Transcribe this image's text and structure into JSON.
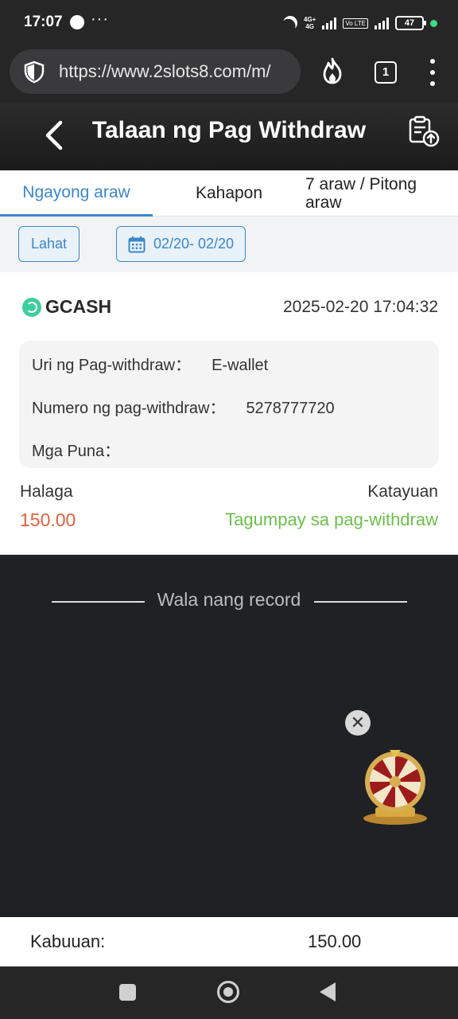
{
  "status_bar": {
    "time": "17:07",
    "dots": "···",
    "network": "4G+",
    "network_sub": "4G",
    "volte": "Vo LTE",
    "battery": "47"
  },
  "browser": {
    "url": "https://www.2slots8.com/m/",
    "tab_count": "1"
  },
  "header": {
    "title": "Talaan ng Pag Withdraw"
  },
  "tabs": [
    {
      "label": "Ngayong araw",
      "active": true
    },
    {
      "label": "Kahapon",
      "active": false
    },
    {
      "label": "7 araw / Pitong araw",
      "active": false
    }
  ],
  "filters": {
    "all_label": "Lahat",
    "date_range": "02/20- 02/20"
  },
  "record": {
    "method": "GCASH",
    "datetime": "2025-02-20 17:04:32",
    "details": [
      {
        "label": "Uri ng Pag-withdraw：",
        "value": "E-wallet"
      },
      {
        "label": "Numero ng pag-withdraw：",
        "value": "5278777720"
      },
      {
        "label": "Mga Puna：",
        "value": ""
      }
    ],
    "amount_label": "Halaga",
    "amount": "150.00",
    "status_label": "Katayuan",
    "status": "Tagumpay sa pag-withdraw"
  },
  "no_more_records": "Wala nang record",
  "total": {
    "label": "Kabuuan:",
    "value": "150.00"
  },
  "colors": {
    "accent": "#3b87c8",
    "amount": "#e0613d",
    "success": "#6cc04a",
    "gcash": "#3ccf9e"
  },
  "icons": [
    "shield-icon",
    "fire-icon",
    "tabs-icon",
    "more-menu-icon",
    "back-arrow-icon",
    "export-icon",
    "calendar-icon",
    "gcash-logo-icon",
    "close-icon",
    "prize-wheel-icon"
  ]
}
